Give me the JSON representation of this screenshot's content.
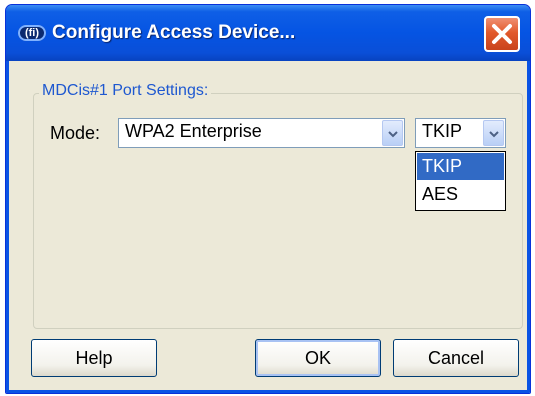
{
  "window": {
    "title": "Configure Access Device...",
    "app_icon_text": "(fi)",
    "close_icon": "close-icon"
  },
  "group": {
    "legend": "MDCis#1 Port Settings:"
  },
  "mode": {
    "label": "Mode:",
    "selected": "WPA2 Enterprise"
  },
  "encryption": {
    "selected": "TKIP",
    "options": [
      {
        "label": "TKIP",
        "highlighted": true
      },
      {
        "label": "AES",
        "highlighted": false
      }
    ]
  },
  "buttons": {
    "help": "Help",
    "ok": "OK",
    "cancel": "Cancel"
  },
  "colors": {
    "titlebar": "#0554e3",
    "close_button": "#e25a2c",
    "dialog_bg": "#ece9d8",
    "selection": "#316ac5",
    "legend_text": "#1e58d0"
  }
}
